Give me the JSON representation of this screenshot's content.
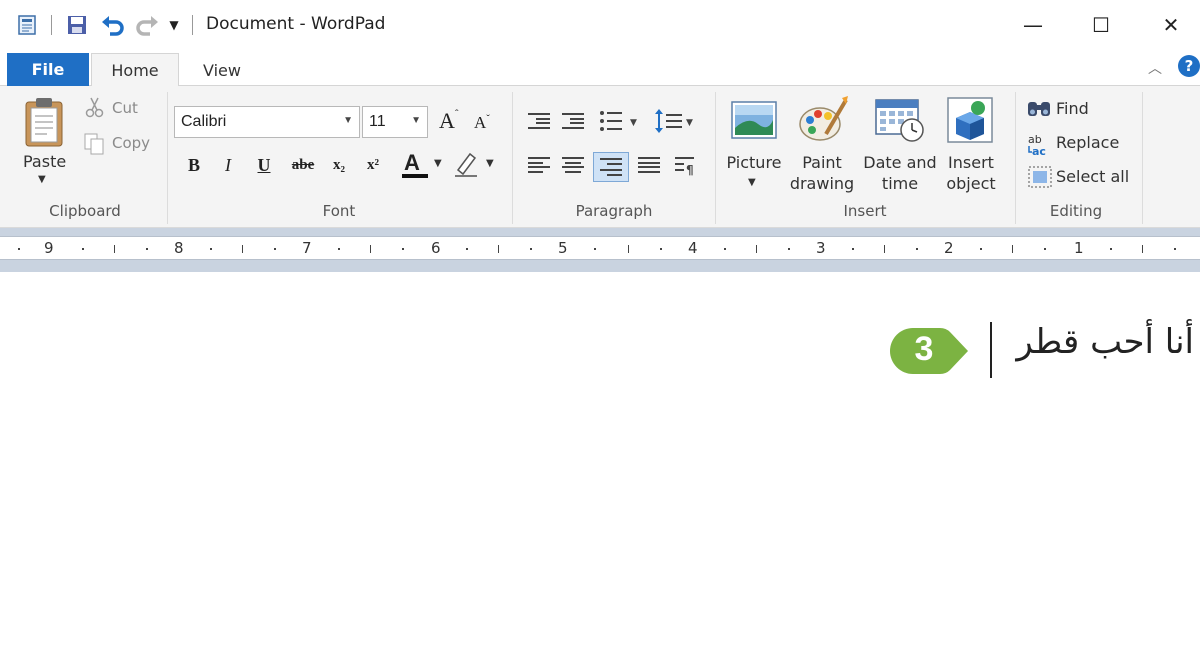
{
  "window": {
    "title": "Document - WordPad",
    "minimize": "—",
    "maximize": "☐",
    "close": "✕"
  },
  "quick_access": {
    "icons": [
      "wordpad-app-icon",
      "save-icon",
      "undo-icon",
      "redo-icon",
      "customize-dropdown-icon"
    ]
  },
  "tabs": {
    "file": "File",
    "home": "Home",
    "view": "View",
    "help": "?"
  },
  "clipboard": {
    "paste": "Paste",
    "cut": "Cut",
    "copy": "Copy",
    "group_label": "Clipboard"
  },
  "font": {
    "family": "Calibri",
    "size": "11",
    "bold": "B",
    "italic": "I",
    "underline": "U",
    "strikethrough": "abe",
    "subscript": "x₂",
    "superscript": "x²",
    "color_glyph": "A",
    "grow": "A",
    "shrink": "A",
    "group_label": "Font"
  },
  "paragraph": {
    "group_label": "Paragraph",
    "selected_alignment": "align-right"
  },
  "insert": {
    "picture": "Picture",
    "paint_drawing": "Paint drawing",
    "paint_line1": "Paint",
    "paint_line2": "drawing",
    "date_line1": "Date and",
    "date_line2": "time",
    "object_line1": "Insert",
    "object_line2": "object",
    "group_label": "Insert"
  },
  "editing": {
    "find": "Find",
    "replace": "Replace",
    "select_all": "Select all",
    "group_label": "Editing"
  },
  "ruler": {
    "numbers": [
      "9",
      "8",
      "7",
      "6",
      "5",
      "4",
      "3",
      "2",
      "1"
    ]
  },
  "document": {
    "text": "أنا أحب قطر",
    "callout_number": "3"
  },
  "colors": {
    "file_tab": "#1f6fc5",
    "callout_green": "#7cb342",
    "ribbon_bg": "#f4f4f4",
    "ruler_band": "#c9d3e0"
  }
}
